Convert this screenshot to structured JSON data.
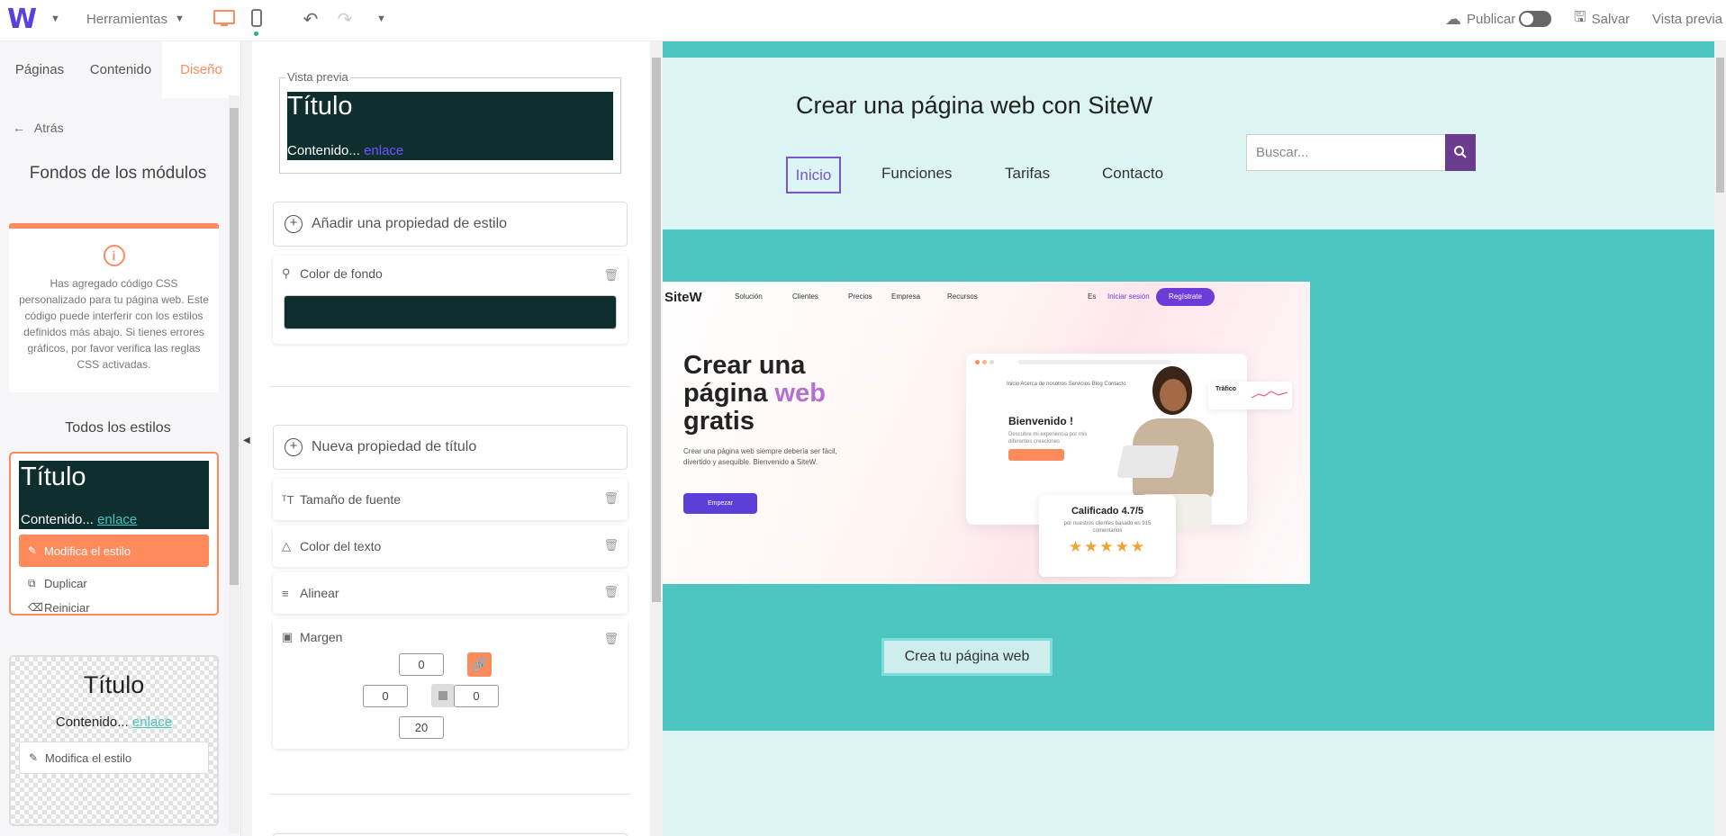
{
  "toolbar": {
    "logo": "W",
    "tools_label": "Herramientas",
    "publish_label": "Publicar",
    "save_label": "Salvar",
    "preview_label": "Vista previa"
  },
  "sidebar": {
    "tabs": [
      "Páginas",
      "Contenido",
      "Diseño"
    ],
    "active_tab": "Diseño",
    "back_label": "Atrás",
    "title": "Fondos de los módulos",
    "warning_text": "Has agregado código CSS personalizado para tu página web. Este código puede interferir con los estilos definidos más abajo. Si tienes errores gráficos, por favor verifica las reglas CSS activadas.",
    "all_styles_label": "Todos los estilos",
    "style1": {
      "title": "Título",
      "content": "Contenido...",
      "link": "enlace",
      "actions": [
        "Modifica el estilo",
        "Duplicar",
        "Reiniciar"
      ]
    },
    "style2": {
      "title": "Título",
      "content": "Contenido...",
      "link": "enlace",
      "action": "Modifica el estilo"
    }
  },
  "editor": {
    "preview_label": "Vista previa",
    "preview_title": "Título",
    "preview_content": "Contenido...",
    "preview_link": "enlace",
    "add_style_property": "Añadir una propiedad de estilo",
    "bg_color_label": "Color de fondo",
    "bg_color_value": "#0f2e2e",
    "new_title_property": "Nueva propiedad de título",
    "font_size_label": "Tamaño de fuente",
    "text_color_label": "Color del texto",
    "align_label": "Alinear",
    "margin_label": "Margen",
    "margin": {
      "top": "0",
      "left": "0",
      "right": "0",
      "bottom": "20"
    }
  },
  "site": {
    "title": "Crear una página web con SiteW",
    "nav": [
      "Inicio",
      "Funciones",
      "Tarifas",
      "Contacto"
    ],
    "active_nav": "Inicio",
    "search_placeholder": "Buscar...",
    "cta_label": "Crea tu página web",
    "colors": {
      "band": "#4dc6c1",
      "light": "#dcf4f3",
      "accent": "#7a55c9"
    }
  },
  "embedded_image": {
    "logo": "SiteW",
    "nav": [
      "Solución",
      "Clientes",
      "Precios",
      "Empresa",
      "Recursos"
    ],
    "lang": "Es",
    "login": "Iniciar sesión",
    "register": "Regístrate",
    "heading_line1": "Crear una",
    "heading_line2a": "página",
    "heading_line2b": "web",
    "heading_line3": "gratis",
    "paragraph": "Crear una página web siempre debería ser fácil, divertido y asequible. Bienvenido a SiteW.",
    "start_button": "Empezar",
    "mock_nav": "Inicio   Acerca de nosotros   Servicios   Blog   Contacto",
    "welcome": "Bienvenido !",
    "welcome_sub": "Descubre mi experiencia por mis diferentes creaciones",
    "traffic": "Tráfico",
    "rating_title": "Calificado 4.7/5",
    "rating_sub": "por nuestros clientes basado en 915 comentarios",
    "stars": "★★★★★"
  }
}
